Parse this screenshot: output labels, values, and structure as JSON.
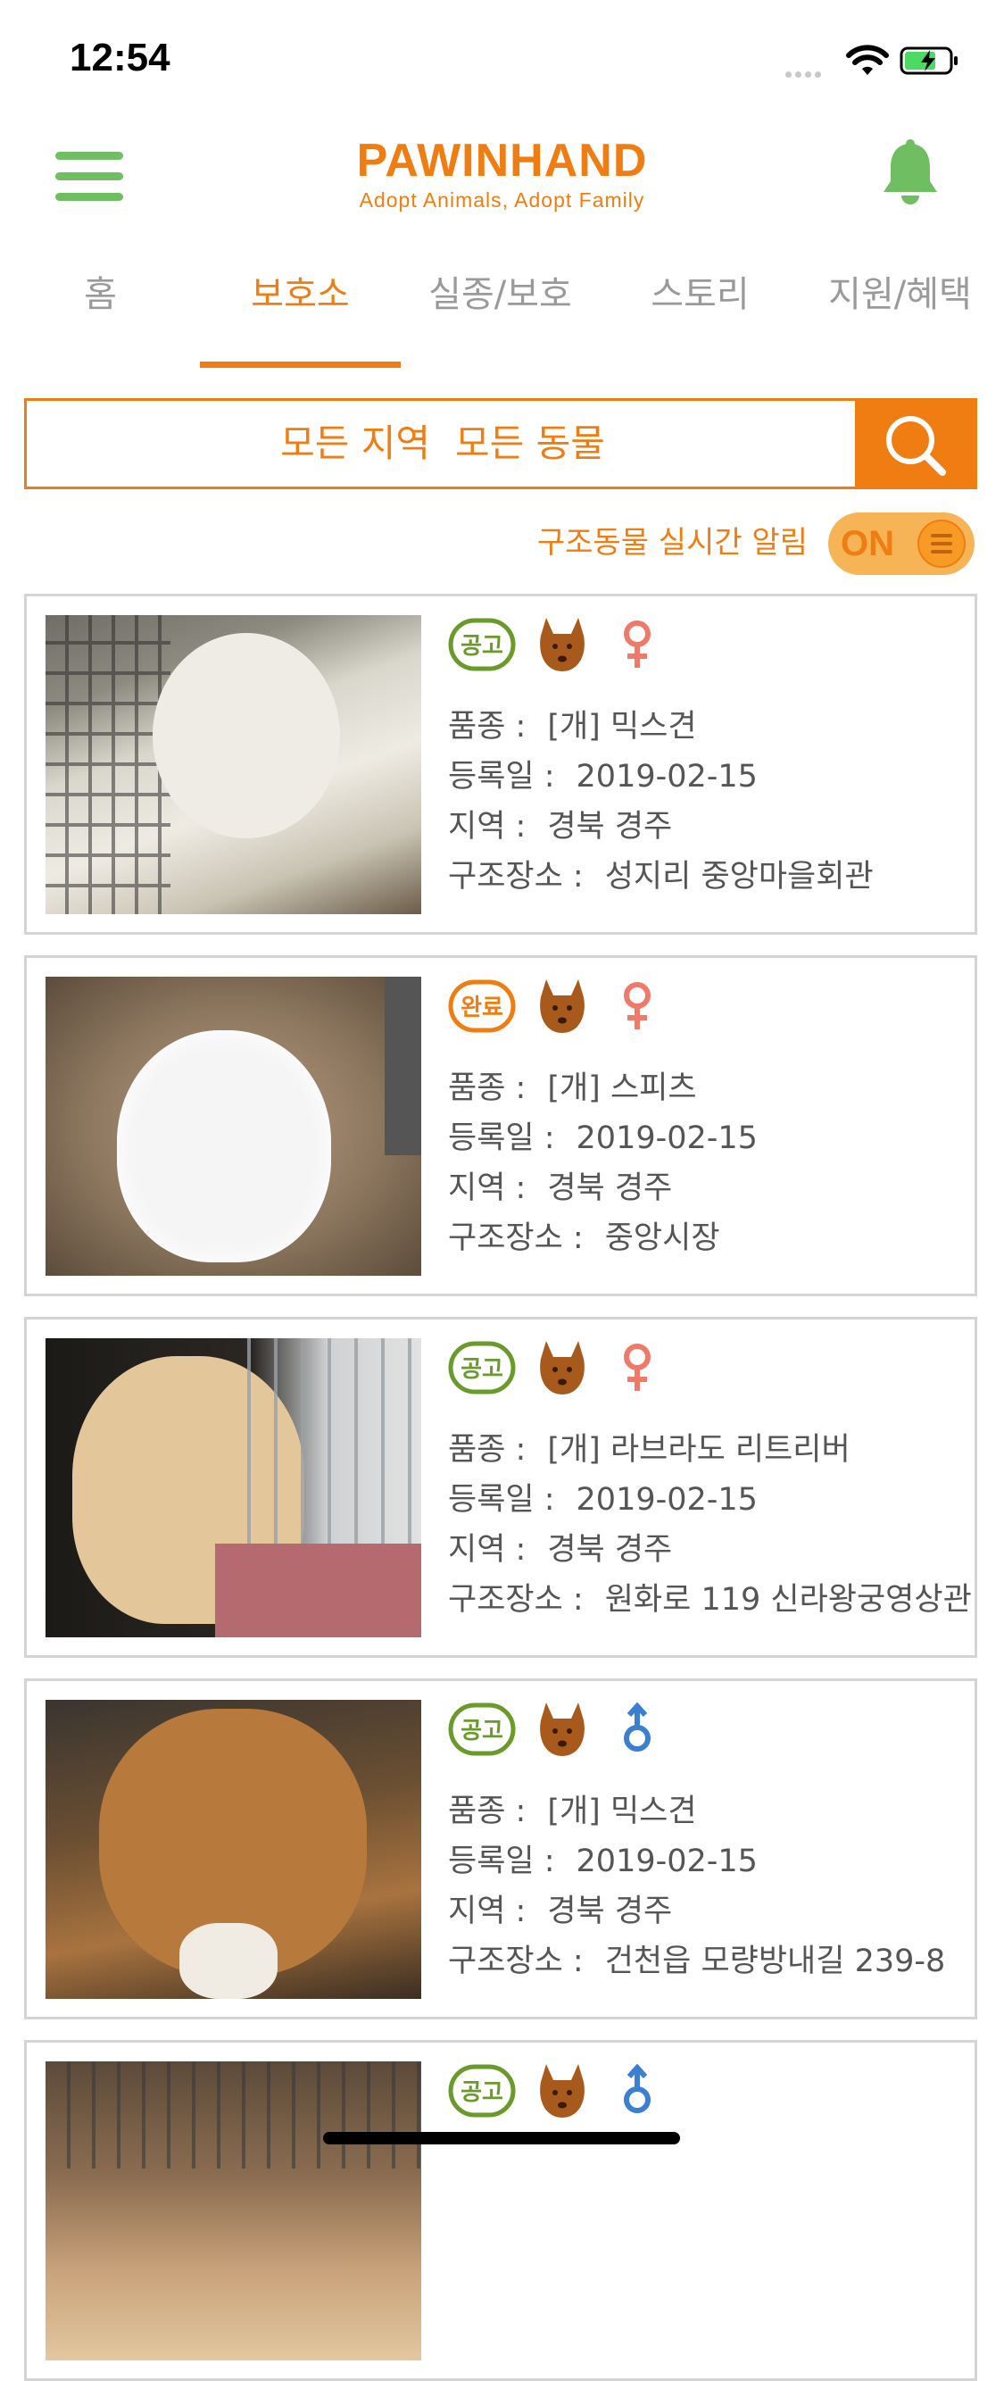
{
  "status_bar": {
    "time": "12:54"
  },
  "header": {
    "brand": "PAWINHAND",
    "tagline": "Adopt Animals, Adopt Family"
  },
  "tabs": [
    {
      "label": "홈"
    },
    {
      "label": "보호소",
      "active": true
    },
    {
      "label": "실종/보호"
    },
    {
      "label": "스토리"
    },
    {
      "label": "지원/혜택"
    }
  ],
  "search": {
    "region": "모든 지역",
    "animal": "모든 동물"
  },
  "realtime_alert": {
    "label": "구조동물 실시간 알림",
    "toggle": "ON"
  },
  "field_labels": {
    "breed": "품종 :",
    "date": "등록일 :",
    "region": "지역 :",
    "place": "구조장소 :"
  },
  "listings": [
    {
      "status": "공고",
      "status_color": "#6a9a2a",
      "sex": "female",
      "breed": "[개] 믹스견",
      "date": "2019-02-15",
      "region": "경북 경주",
      "place": "성지리 중앙마을회관"
    },
    {
      "status": "완료",
      "status_color": "#f07d12",
      "sex": "female",
      "breed": "[개] 스피츠",
      "date": "2019-02-15",
      "region": "경북 경주",
      "place": "중앙시장"
    },
    {
      "status": "공고",
      "status_color": "#6a9a2a",
      "sex": "female",
      "breed": "[개] 라브라도 리트리버",
      "date": "2019-02-15",
      "region": "경북 경주",
      "place": "원화로 119 신라왕궁영상관"
    },
    {
      "status": "공고",
      "status_color": "#6a9a2a",
      "sex": "male",
      "breed": "[개] 믹스견",
      "date": "2019-02-15",
      "region": "경북 경주",
      "place": "건천읍 모량방내길 239-8"
    },
    {
      "status": "공고",
      "status_color": "#6a9a2a",
      "sex": "male"
    }
  ],
  "colors": {
    "accent": "#f07d12",
    "green": "#6fbf62",
    "female": "#f07a6a",
    "male": "#3a7fd0"
  }
}
